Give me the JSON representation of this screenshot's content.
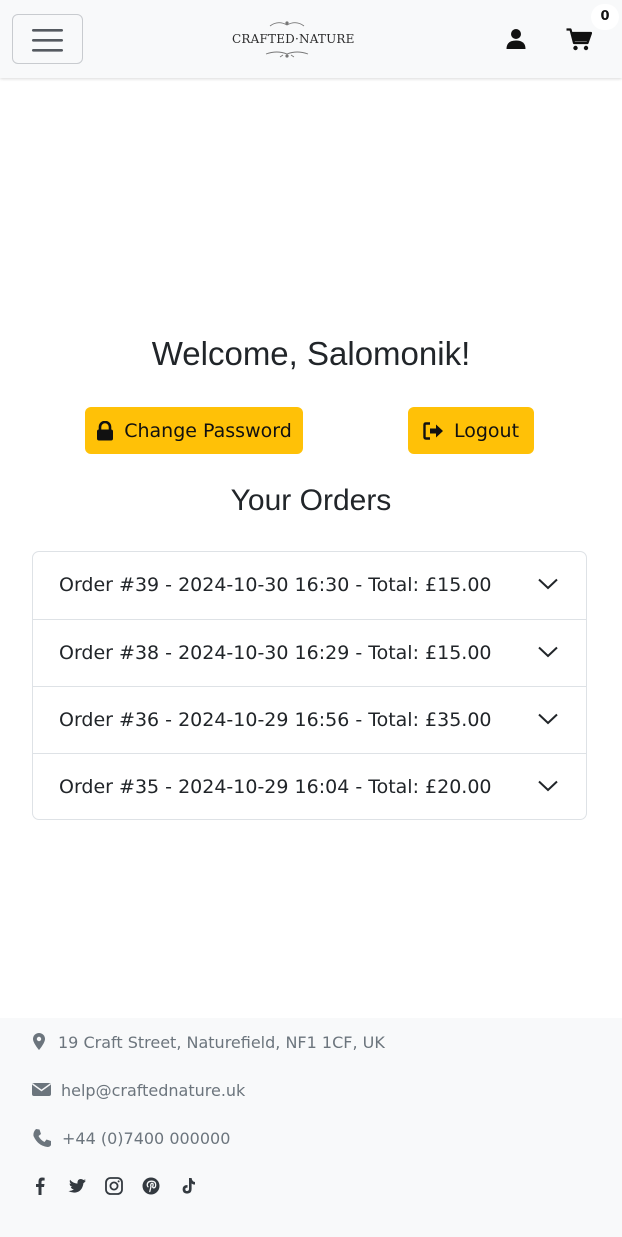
{
  "header": {
    "brand": "CRAFTED·NATURE",
    "cart_count": "0"
  },
  "account": {
    "welcome": "Welcome, Salomonik!",
    "change_password_label": "Change Password",
    "logout_label": "Logout",
    "orders_title": "Your Orders"
  },
  "orders": [
    {
      "label": "Order #39 - 2024-10-30 16:30 - Total: £15.00"
    },
    {
      "label": "Order #38 - 2024-10-30 16:29 - Total: £15.00"
    },
    {
      "label": "Order #36 - 2024-10-29 16:56 - Total: £35.00"
    },
    {
      "label": "Order #35 - 2024-10-29 16:04 - Total: £20.00"
    }
  ],
  "footer": {
    "address": "19 Craft Street, Naturefield, NF1 1CF, UK",
    "email": "help@craftednature.uk",
    "phone": "+44 (0)7400 000000",
    "socials": [
      "facebook-icon",
      "twitter-icon",
      "instagram-icon",
      "pinterest-icon",
      "tiktok-icon"
    ]
  },
  "colors": {
    "accent": "#ffc107",
    "navbar_bg": "#f8f9fa",
    "muted_text": "#6c757d"
  }
}
